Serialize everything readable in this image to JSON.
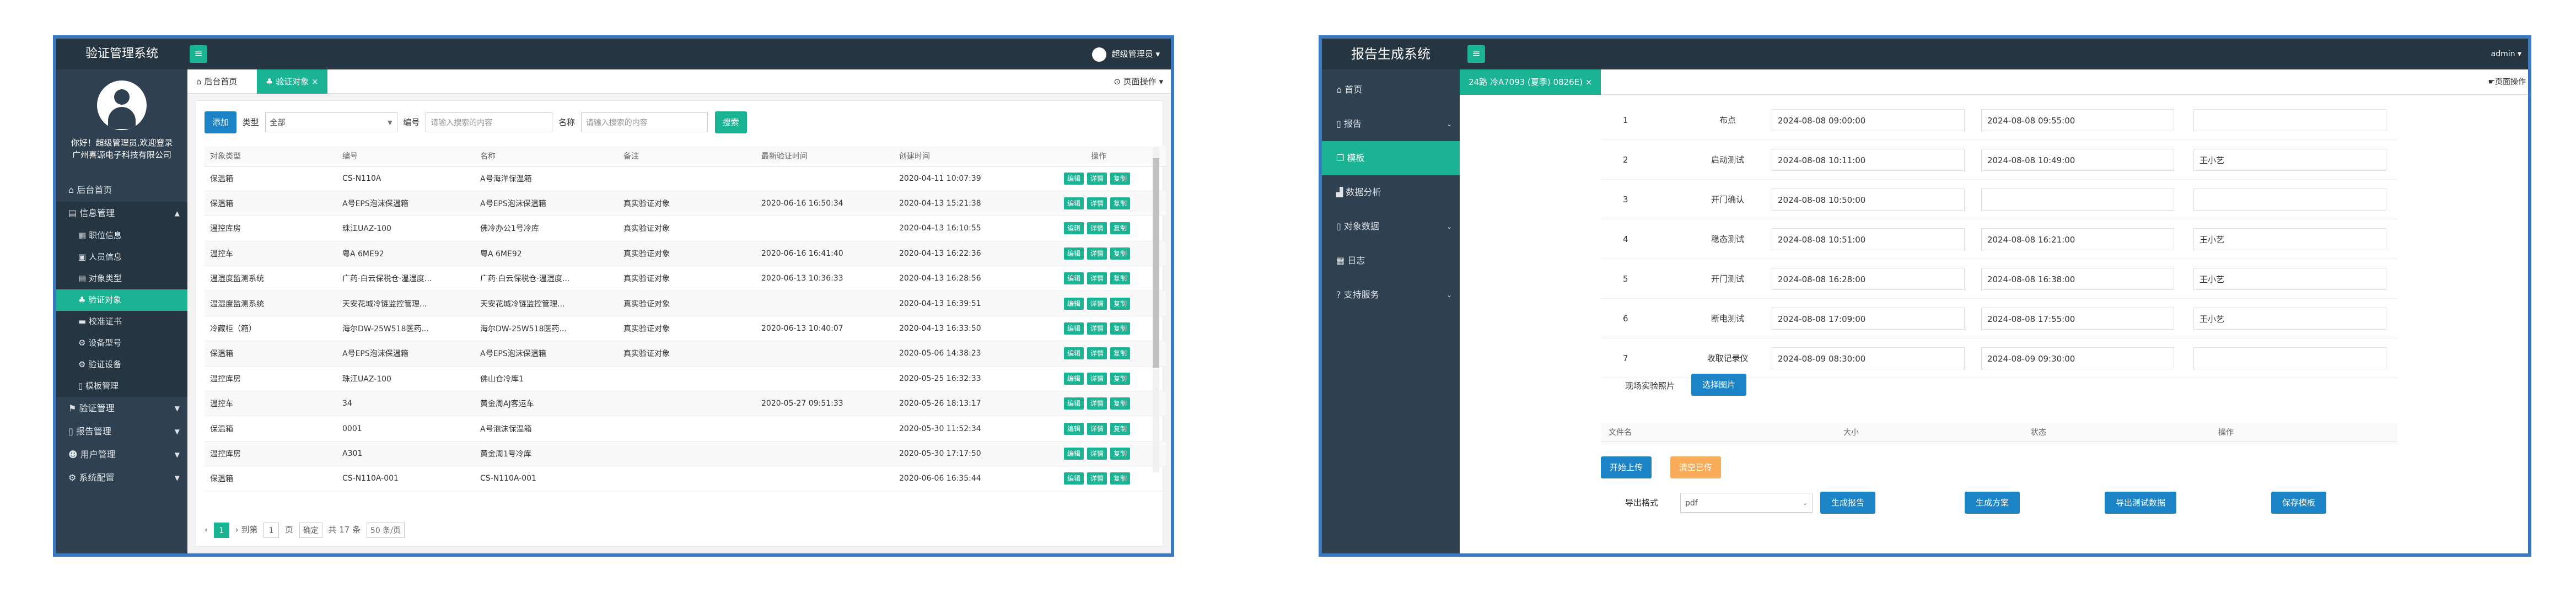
{
  "winA": {
    "app_title": "验证管理系统",
    "welcome_line1": "你好！超级管理员,欢迎登录",
    "welcome_line2": "广州喜源电子科技有限公司",
    "user_label": "超级管理员",
    "nav": [
      {
        "label": "后台首页"
      },
      {
        "label": "信息管理"
      },
      {
        "label": "职位信息"
      },
      {
        "label": "人员信息"
      },
      {
        "label": "对象类型"
      },
      {
        "label": "验证对象"
      },
      {
        "label": "校准证书"
      },
      {
        "label": "设备型号"
      },
      {
        "label": "验证设备"
      },
      {
        "label": "模板管理"
      },
      {
        "label": "验证管理"
      },
      {
        "label": "报告管理"
      },
      {
        "label": "用户管理"
      },
      {
        "label": "系统配置"
      }
    ],
    "tabs": [
      {
        "label": "后台首页"
      },
      {
        "label": "验证对象"
      }
    ],
    "page_ops": "页面操作",
    "add_label": "添加",
    "type_label": "类型",
    "type_value": "全部",
    "code_label": "编号",
    "code_placeholder": "请输入搜索的内容",
    "name_label": "名称",
    "name_placeholder": "请输入搜索的内容",
    "search_label": "搜索",
    "columns": [
      "对象类型",
      "编号",
      "名称",
      "备注",
      "最新验证时间",
      "创建时间",
      "操作"
    ],
    "rows": [
      [
        "保温箱",
        "CS-N110A",
        "A号海洋保温箱",
        "",
        "",
        "2020-04-11 10:07:39"
      ],
      [
        "保温箱",
        "A号EPS泡沫保温箱",
        "A号EPS泡沫保温箱",
        "真实验证对象",
        "2020-06-16 16:50:34",
        "2020-04-13 15:21:38"
      ],
      [
        "温控库房",
        "珠江UAZ-100",
        "佛冷办公1号冷库",
        "真实验证对象",
        "",
        "2020-04-13 16:10:55"
      ],
      [
        "温控车",
        "粤A 6ME92",
        "粤A 6ME92",
        "真实验证对象",
        "2020-06-16 16:41:40",
        "2020-04-13 16:22:36"
      ],
      [
        "温湿度监测系统",
        "广药·白云保税仓·温湿度...",
        "广药·白云保税仓·温湿度...",
        "真实验证对象",
        "2020-06-13 10:36:33",
        "2020-04-13 16:28:56"
      ],
      [
        "温湿度监测系统",
        "天安花城冷链监控管理...",
        "天安花城冷链监控管理...",
        "真实验证对象",
        "",
        "2020-04-13 16:39:51"
      ],
      [
        "冷藏柜（箱）",
        "海尔DW-25W518医药...",
        "海尔DW-25W518医药...",
        "真实验证对象",
        "2020-06-13 10:40:07",
        "2020-04-13 16:33:50"
      ],
      [
        "保温箱",
        "A号EPS泡沫保温箱",
        "A号EPS泡沫保温箱",
        "真实验证对象",
        "",
        "2020-05-06 14:38:23"
      ],
      [
        "温控库房",
        "珠江UAZ-100",
        "佛山仓冷库1",
        "",
        "",
        "2020-05-25 16:32:33"
      ],
      [
        "温控车",
        "34",
        "黄金周AJ客运车",
        "",
        "2020-05-27 09:51:33",
        "2020-05-26 18:13:17"
      ],
      [
        "保温箱",
        "0001",
        "A号泡沫保温箱",
        "",
        "",
        "2020-05-30 11:52:34"
      ],
      [
        "温控库房",
        "A301",
        "黄金周1号冷库",
        "",
        "",
        "2020-05-30 17:17:50"
      ],
      [
        "保温箱",
        "CS-N110A-001",
        "CS-N110A-001",
        "",
        "",
        "2020-06-06 16:35:44"
      ]
    ],
    "op_buttons": [
      "编辑",
      "详情",
      "复制"
    ],
    "pager": {
      "current": "1",
      "goto_label": "到第",
      "goto_value": "1",
      "page_label": "页",
      "confirm": "确定",
      "total": "共 17 条",
      "per_page": "50 条/页"
    }
  },
  "winB": {
    "app_title": "报告生成系统",
    "user_label": "admin",
    "nav": [
      {
        "label": "首页"
      },
      {
        "label": "报告"
      },
      {
        "label": "模板"
      },
      {
        "label": "数据分析"
      },
      {
        "label": "对象数据"
      },
      {
        "label": "日志"
      },
      {
        "label": "支持服务"
      }
    ],
    "tab_label": "24路 冷A7093 (夏季) 0826E)",
    "page_ops": "页面操作",
    "rows": [
      {
        "no": "1",
        "name": "布点",
        "start": "2024-08-08 09:00:00",
        "end": "2024-08-08 09:55:00",
        "person": ""
      },
      {
        "no": "2",
        "name": "启动测试",
        "start": "2024-08-08 10:11:00",
        "end": "2024-08-08 10:49:00",
        "person": "王小艺"
      },
      {
        "no": "3",
        "name": "开门确认",
        "start": "2024-08-08 10:50:00",
        "end": "",
        "person": ""
      },
      {
        "no": "4",
        "name": "稳态测试",
        "start": "2024-08-08 10:51:00",
        "end": "2024-08-08 16:21:00",
        "person": "王小艺"
      },
      {
        "no": "5",
        "name": "开门测试",
        "start": "2024-08-08 16:28:00",
        "end": "2024-08-08 16:38:00",
        "person": "王小艺"
      },
      {
        "no": "6",
        "name": "断电测试",
        "start": "2024-08-08 17:09:00",
        "end": "2024-08-08 17:55:00",
        "person": "王小艺"
      },
      {
        "no": "7",
        "name": "收取记录仪",
        "start": "2024-08-09 08:30:00",
        "end": "2024-08-09 09:30:00",
        "person": ""
      }
    ],
    "photo_label": "现场实验照片",
    "choose_photo": "选择图片",
    "file_columns": [
      "文件名",
      "大小",
      "状态",
      "操作"
    ],
    "upload_label": "开始上传",
    "upload_done_label": "清空已传",
    "export_label": "导出格式",
    "export_value": "pdf",
    "actions": [
      "生成报告",
      "生成方案",
      "导出测试数据",
      "保存模板"
    ]
  }
}
